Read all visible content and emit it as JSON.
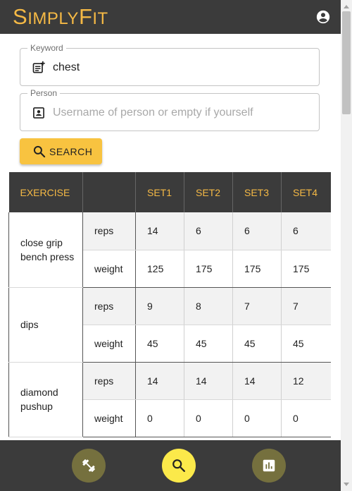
{
  "app": {
    "logo_parts": [
      {
        "text": "S",
        "cls": "cap"
      },
      {
        "text": "IMPLY",
        "cls": "sm"
      },
      {
        "text": "F",
        "cls": "cap"
      },
      {
        "text": "IT",
        "cls": "sm"
      }
    ],
    "account_icon": "account-circle-icon"
  },
  "search": {
    "keyword_label": "Keyword",
    "keyword_value": "chest",
    "keyword_icon": "note-add-icon",
    "person_label": "Person",
    "person_value": "",
    "person_placeholder": "Username of person or empty if yourself",
    "person_icon": "contact-card-icon",
    "button_label": "SEARCH",
    "button_icon": "search-icon"
  },
  "table": {
    "headers": [
      "EXERCISE",
      "",
      "SET1",
      "SET2",
      "SET3",
      "SET4"
    ],
    "rows": [
      {
        "exercise": "close grip bench press",
        "reps": [
          "14",
          "6",
          "6",
          "6"
        ],
        "weight": [
          "125",
          "175",
          "175",
          "175"
        ]
      },
      {
        "exercise": "dips",
        "reps": [
          "9",
          "8",
          "7",
          "7"
        ],
        "weight": [
          "45",
          "45",
          "45",
          "45"
        ]
      },
      {
        "exercise": "diamond pushup",
        "reps": [
          "14",
          "14",
          "14",
          "12"
        ],
        "weight": [
          "0",
          "0",
          "0",
          "0"
        ]
      }
    ],
    "reps_label": "reps",
    "weight_label": "weight"
  },
  "bottom_nav": [
    {
      "name": "workout-nav",
      "icon": "fitness-dumbbell-icon",
      "active": false
    },
    {
      "name": "search-nav",
      "icon": "search-icon",
      "active": true
    },
    {
      "name": "stats-nav",
      "icon": "bar-chart-icon",
      "active": false
    }
  ],
  "colors": {
    "brand": "#f5b945",
    "header_bg": "#3b3b3b",
    "button": "#f8c340",
    "nav_active": "#fbe94a",
    "nav_inactive": "#75703e"
  }
}
